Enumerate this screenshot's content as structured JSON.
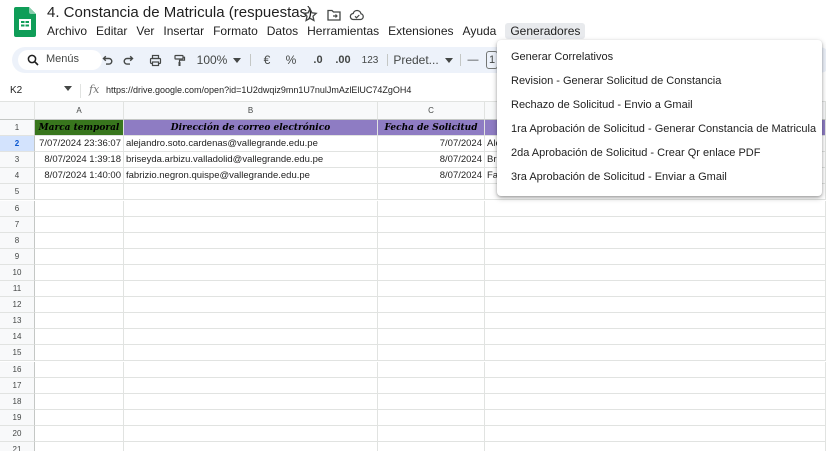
{
  "app": {
    "title": "4. Constancia de Matricula  (respuestas)",
    "icons": [
      "sheets-logo",
      "star-icon",
      "move-folder-icon",
      "cloud-status-icon"
    ]
  },
  "menubar": [
    "Archivo",
    "Editar",
    "Ver",
    "Insertar",
    "Formato",
    "Datos",
    "Herramientas",
    "Extensiones",
    "Ayuda",
    "Generadores"
  ],
  "toolbar": {
    "search_label": "Menús",
    "zoom": "100%",
    "currency": "€",
    "percent": "%",
    "dec_decrease": ".0",
    "dec_increase": ".00",
    "number_format": "123",
    "font": "Predet...",
    "font_size_minus": "—",
    "font_size": "1"
  },
  "formula_bar": {
    "cell_ref": "K2",
    "fx": "fx",
    "value": "https://drive.google.com/open?id=1U2dwqiz9mn1U7nulJmAzlElUC74ZgOH4"
  },
  "grid": {
    "columns": [
      "A",
      "B",
      "C"
    ],
    "header_row": [
      "Marca temporal",
      "Dirección de correo electrónico",
      "Fecha de Solicitud"
    ],
    "rows": [
      [
        "7/07/2024 23:36:07",
        "alejandro.soto.cardenas@vallegrande.edu.pe",
        "7/07/2024",
        "Ale"
      ],
      [
        "8/07/2024 1:39:18",
        "briseyda.arbizu.valladolid@vallegrande.edu.pe",
        "8/07/2024",
        "Bri"
      ],
      [
        "8/07/2024 1:40:00",
        "fabrizio.negron.quispe@vallegrande.edu.pe",
        "8/07/2024",
        "Fa"
      ]
    ],
    "row_numbers": [
      "1",
      "2",
      "3",
      "4",
      "5",
      "6",
      "7",
      "8",
      "9",
      "10",
      "11",
      "12",
      "13",
      "14",
      "15",
      "16",
      "17",
      "18",
      "19",
      "20",
      "21"
    ],
    "colors": {
      "header_a": "#38761d",
      "header_rest": "#8e7cc3"
    }
  },
  "generadores_menu": [
    "Generar Correlativos",
    "Revision - Generar Solicitud de Constancia",
    "Rechazo de Solicitud - Envio a Gmail",
    "1ra Aprobación de Solicitud - Generar Constancia de Matricula",
    "2da Aprobación de Solicitud - Crear Qr enlace PDF",
    "3ra Aprobación de Solicitud - Enviar a Gmail"
  ]
}
